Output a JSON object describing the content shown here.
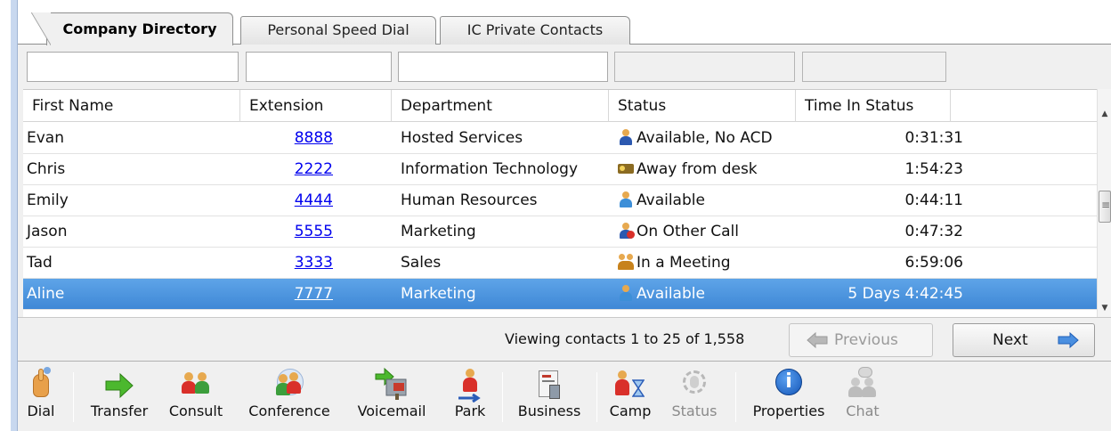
{
  "tabs": [
    "Company Directory",
    "Personal Speed Dial",
    "IC Private Contacts"
  ],
  "columns": [
    "First Name",
    "Extension",
    "Department",
    "Status",
    "Time In Status"
  ],
  "rows": [
    {
      "first": "Evan",
      "ext": "8888",
      "dept": "Hosted Services",
      "status": "Available, No ACD",
      "time": "0:31:31"
    },
    {
      "first": "Chris",
      "ext": "2222",
      "dept": "Information Technology",
      "status": "Away from desk",
      "time": "1:54:23"
    },
    {
      "first": "Emily",
      "ext": "4444",
      "dept": "Human Resources",
      "status": "Available",
      "time": "0:44:11"
    },
    {
      "first": "Jason",
      "ext": "5555",
      "dept": "Marketing",
      "status": "On Other Call",
      "time": "0:47:32"
    },
    {
      "first": "Tad",
      "ext": "3333",
      "dept": "Sales",
      "status": "In a Meeting",
      "time": "6:59:06"
    },
    {
      "first": "Aline",
      "ext": "7777",
      "dept": "Marketing",
      "status": "Available",
      "time": "5 Days 4:42:45"
    }
  ],
  "pager": {
    "viewing": "Viewing contacts 1 to 25 of 1,558",
    "previous": "Previous",
    "next": "Next"
  },
  "toolbar": {
    "dial": "Dial",
    "transfer": "Transfer",
    "consult": "Consult",
    "conference": "Conference",
    "voicemail": "Voicemail",
    "park": "Park",
    "business": "Business",
    "camp": "Camp",
    "status": "Status",
    "properties": "Properties",
    "chat": "Chat"
  },
  "colors": {
    "selection": "#3f88d6",
    "link": "#0000ee",
    "tab_border": "#8e8f8f"
  }
}
